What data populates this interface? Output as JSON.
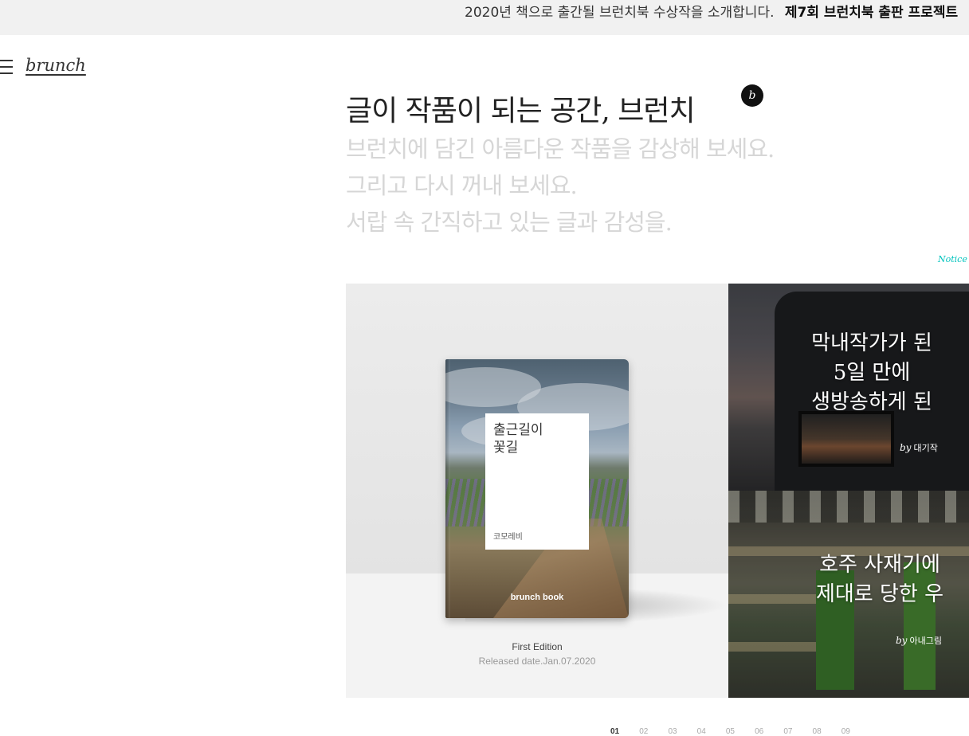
{
  "topbar": {
    "text": "2020년 책으로 출간될 브런치북 수상작을 소개합니다.",
    "strong": "제7회 브런치북 출판 프로젝트"
  },
  "header": {
    "menu_icon": "hamburger-icon",
    "logo": "brunch"
  },
  "hero": {
    "title": "글이 작품이 되는 공간, 브런치",
    "badge": "b",
    "lines": [
      "브런치에 담긴 아름다운 작품을 감상해 보세요.",
      "그리고 다시 꺼내 보세요.",
      "서랍 속 간직하고 있는 글과 감성을."
    ]
  },
  "notice_link": "Notice",
  "book": {
    "title": "출근길이\n꽃길",
    "author": "코모레비",
    "brand": "brunch book",
    "edition": "First Edition",
    "released": "Released date.Jan.07.2020"
  },
  "features": [
    {
      "title": "막내작가가 된\n5일 만에\n생방송하게 된",
      "by": "by",
      "author": "대기작"
    },
    {
      "title": "호주 사재기에\n제대로 당한 우",
      "by": "by",
      "author": "아내그림"
    }
  ],
  "pager": [
    "01",
    "02",
    "03",
    "04",
    "05",
    "06",
    "07",
    "08",
    "09"
  ],
  "pager_active": "01",
  "colors": {
    "accent": "#00c3bd",
    "topbar_bg": "#f1f1f1",
    "subline": "#d6d6d6"
  }
}
